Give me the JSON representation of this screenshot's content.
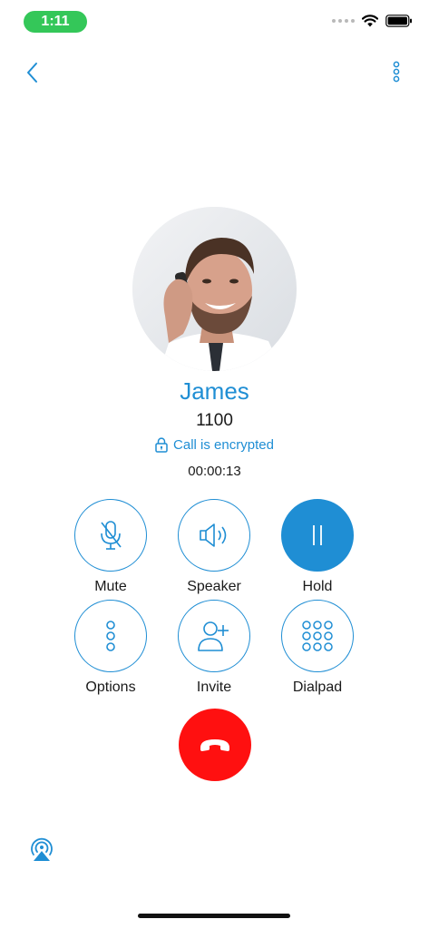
{
  "status_bar": {
    "time": "1:11"
  },
  "caller": {
    "name": "James",
    "number": "1100",
    "encryption_status": "Call is encrypted",
    "duration": "00:00:13"
  },
  "controls": {
    "mute": "Mute",
    "speaker": "Speaker",
    "hold": "Hold",
    "options": "Options",
    "invite": "Invite",
    "dialpad": "Dialpad"
  },
  "icons": {
    "back": "chevron-left-icon",
    "more": "more-vertical-icon",
    "lock": "lock-icon",
    "mute": "microphone-off-icon",
    "speaker": "speaker-icon",
    "hold": "pause-icon",
    "options": "more-vertical-icon",
    "invite": "add-user-icon",
    "dialpad": "dialpad-icon",
    "end_call": "hang-up-icon",
    "airplay": "airplay-icon"
  },
  "colors": {
    "accent": "#1f8ed4",
    "end_call": "#ff1010",
    "status_green": "#34c759"
  }
}
